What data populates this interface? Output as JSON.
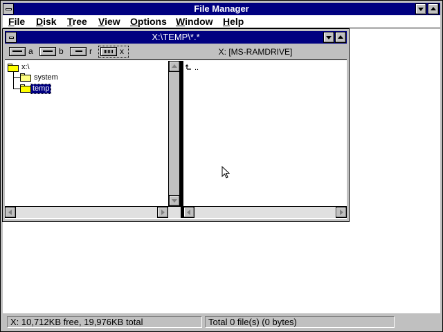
{
  "app": {
    "title": "File Manager"
  },
  "menu": {
    "items": [
      {
        "label": "File",
        "accel": "F",
        "rest": "ile"
      },
      {
        "label": "Disk",
        "accel": "D",
        "rest": "isk"
      },
      {
        "label": "Tree",
        "accel": "T",
        "rest": "ree"
      },
      {
        "label": "View",
        "accel": "V",
        "rest": "iew"
      },
      {
        "label": "Options",
        "accel": "O",
        "rest": "ptions"
      },
      {
        "label": "Window",
        "accel": "W",
        "rest": "indow"
      },
      {
        "label": "Help",
        "accel": "H",
        "rest": "elp"
      }
    ]
  },
  "child_window": {
    "title": "X:\\TEMP\\*.*",
    "volume_label": "X: [MS-RAMDRIVE]",
    "drives": [
      {
        "letter": "a",
        "icon": "floppy-drive-icon"
      },
      {
        "letter": "b",
        "icon": "floppy-drive-icon"
      },
      {
        "letter": "r",
        "icon": "cdrom-drive-icon"
      },
      {
        "letter": "x",
        "icon": "ram-drive-icon",
        "selected": true
      }
    ]
  },
  "tree": {
    "root": "x:\\",
    "items": [
      {
        "label": "system",
        "icon": "folder-icon"
      },
      {
        "label": "temp",
        "icon": "open-folder-icon",
        "selected": true
      }
    ]
  },
  "files": {
    "updir": "..",
    "updir_icon": "up-arrow-icon"
  },
  "status": {
    "disk": "X: 10,712KB free,  19,976KB total",
    "files": "Total 0 file(s) (0 bytes)"
  }
}
